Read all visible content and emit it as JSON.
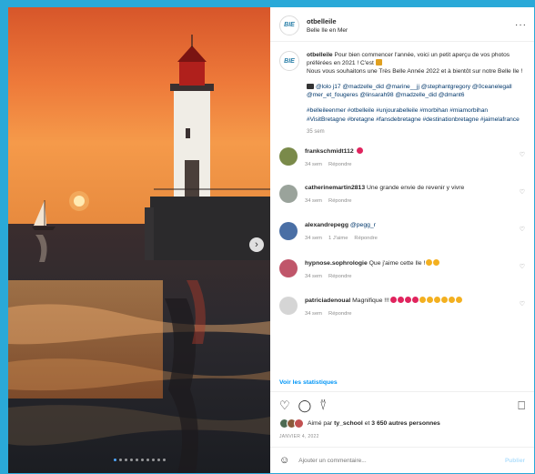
{
  "post": {
    "username": "otbelleile",
    "location": "Belle Ile en Mer",
    "more_label": "···",
    "avatar_text": "BIE"
  },
  "photo": {
    "dot_count": 10,
    "active_dot": 0,
    "next_label": "›"
  },
  "caption": {
    "username": "otbelleile",
    "line1": "Pour bien commencer l'année, voici un petit aperçu de vos photos préférées en 2021 ! C'est",
    "line2": "Nous vous souhaitons une Très Belle Année 2022 et à bientôt sur notre Belle Ile !",
    "mentions": "@lolo j17 @madzelle_did @marine__jj @stephantgregory @0ceanelegall @mer_et_fougeres @linsarah98 @madzelle_did @dmant6",
    "hashtags": "#belleileenmer #otbelleile #unjourabelleile #morbihan #miamorbihan #VisitBretagne #bretagne #fansdebretagne #destinationbretagne #jaimelafrance",
    "ago": "35 sem"
  },
  "comments": [
    {
      "username": "frankschmidt112",
      "text": "",
      "emoji": "red-heart",
      "ago": "34 sem",
      "likes": "",
      "reply": "Répondre",
      "avatar_color": "#7a8a4a"
    },
    {
      "username": "catherinemartin2813",
      "text": "Une grande envie de revenir y vivre",
      "emoji": "",
      "ago": "34 sem",
      "likes": "",
      "reply": "Répondre",
      "avatar_color": "#9aa39b"
    },
    {
      "username": "alexandrepegg",
      "text": "@pegg_r",
      "emoji": "",
      "ago": "34 sem",
      "likes": "1 J'aime",
      "reply": "Répondre",
      "avatar_color": "#4a6fa5"
    },
    {
      "username": "hypnose.sophrologie",
      "text": "Que j'aime cette Ile !",
      "emoji": "smiley-hearts",
      "ago": "34 sem",
      "likes": "",
      "reply": "Répondre",
      "avatar_color": "#c0566a"
    },
    {
      "username": "patriciadenoual",
      "text": "Magnifique !!!",
      "emoji": "many",
      "ago": "34 sem",
      "likes": "",
      "reply": "Répondre",
      "avatar_color": "#d5d5d5"
    }
  ],
  "stats_label": "Voir les statistiques",
  "actions": {
    "like_icon": "heart-outline-icon",
    "comment_icon": "comment-icon",
    "share_icon": "send-icon",
    "save_icon": "bookmark-icon"
  },
  "likes": {
    "prefix": "Aimé par",
    "user": "ty_school",
    "middle": "et",
    "count": "3 650 autres personnes"
  },
  "date": "JANVIER 4, 2022",
  "add_comment": {
    "placeholder": "Ajouter un commentaire...",
    "publish": "Publier"
  },
  "colors": {
    "background": "#2aa9d8",
    "link": "#0095f6",
    "mention": "#00376b",
    "muted": "#8e8e8e"
  }
}
